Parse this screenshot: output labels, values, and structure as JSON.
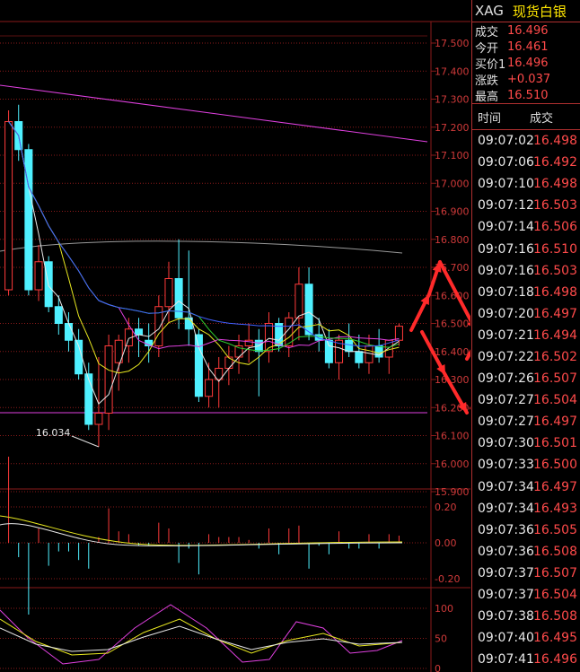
{
  "quote": {
    "symbol": "XAG",
    "name": "现货白银",
    "rows": [
      {
        "label": "成交",
        "value": "16.496"
      },
      {
        "label": "今开",
        "value": "16.461"
      },
      {
        "label": "买价1",
        "value": "16.496"
      },
      {
        "label": "涨跌",
        "value": "+0.037"
      },
      {
        "label": "最高",
        "value": "16.510"
      }
    ]
  },
  "ticks": {
    "headers": [
      "时间",
      "成交"
    ],
    "rows": [
      {
        "time": "09:07:02",
        "price": "16.498"
      },
      {
        "time": "09:07:06",
        "price": "16.492"
      },
      {
        "time": "09:07:10",
        "price": "16.498"
      },
      {
        "time": "09:07:12",
        "price": "16.503"
      },
      {
        "time": "09:07:14",
        "price": "16.506"
      },
      {
        "time": "09:07:16",
        "price": "16.510"
      },
      {
        "time": "09:07:16",
        "price": "16.503"
      },
      {
        "time": "09:07:18",
        "price": "16.498"
      },
      {
        "time": "09:07:20",
        "price": "16.497"
      },
      {
        "time": "09:07:21",
        "price": "16.494"
      },
      {
        "time": "09:07:22",
        "price": "16.502"
      },
      {
        "time": "09:07:26",
        "price": "16.507"
      },
      {
        "time": "09:07:27",
        "price": "16.504"
      },
      {
        "time": "09:07:27",
        "price": "16.497"
      },
      {
        "time": "09:07:30",
        "price": "16.501"
      },
      {
        "time": "09:07:33",
        "price": "16.500"
      },
      {
        "time": "09:07:34",
        "price": "16.497"
      },
      {
        "time": "09:07:34",
        "price": "16.493"
      },
      {
        "time": "09:07:36",
        "price": "16.505"
      },
      {
        "time": "09:07:36",
        "price": "16.508"
      },
      {
        "time": "09:07:37",
        "price": "16.507"
      },
      {
        "time": "09:07:37",
        "price": "16.504"
      },
      {
        "time": "09:07:38",
        "price": "16.508"
      },
      {
        "time": "09:07:40",
        "price": "16.495"
      },
      {
        "time": "09:07:41",
        "price": "16.496"
      }
    ]
  },
  "chart_data": {
    "type": "candlestick",
    "price_axis": {
      "ticks": [
        "17.500",
        "17.400",
        "17.300",
        "17.200",
        "17.100",
        "17.000",
        "16.900",
        "16.800",
        "16.700",
        "16.600",
        "16.500",
        "16.400",
        "16.300",
        "16.200",
        "16.100",
        "16.000",
        "15.900"
      ],
      "ylim": [
        15.9,
        17.5
      ]
    },
    "low_annotation": "16.034",
    "candles": [
      {
        "o": 16.62,
        "h": 17.26,
        "l": 16.6,
        "c": 17.22
      },
      {
        "o": 17.22,
        "h": 17.28,
        "l": 17.08,
        "c": 17.12
      },
      {
        "o": 17.12,
        "h": 17.14,
        "l": 16.6,
        "c": 16.62
      },
      {
        "o": 16.62,
        "h": 16.78,
        "l": 16.58,
        "c": 16.72
      },
      {
        "o": 16.72,
        "h": 16.74,
        "l": 16.54,
        "c": 16.56
      },
      {
        "o": 16.56,
        "h": 16.6,
        "l": 16.46,
        "c": 16.5
      },
      {
        "o": 16.5,
        "h": 16.54,
        "l": 16.4,
        "c": 16.44
      },
      {
        "o": 16.44,
        "h": 16.48,
        "l": 16.3,
        "c": 16.32
      },
      {
        "o": 16.32,
        "h": 16.36,
        "l": 16.12,
        "c": 16.14
      },
      {
        "o": 16.14,
        "h": 16.38,
        "l": 16.06,
        "c": 16.18
      },
      {
        "o": 16.18,
        "h": 16.46,
        "l": 16.12,
        "c": 16.42
      },
      {
        "o": 16.36,
        "h": 16.46,
        "l": 16.26,
        "c": 16.44
      },
      {
        "o": 16.42,
        "h": 16.52,
        "l": 16.36,
        "c": 16.48
      },
      {
        "o": 16.48,
        "h": 16.52,
        "l": 16.38,
        "c": 16.46
      },
      {
        "o": 16.44,
        "h": 16.5,
        "l": 16.36,
        "c": 16.42
      },
      {
        "o": 16.42,
        "h": 16.6,
        "l": 16.38,
        "c": 16.56
      },
      {
        "o": 16.56,
        "h": 16.72,
        "l": 16.5,
        "c": 16.66
      },
      {
        "o": 16.66,
        "h": 16.8,
        "l": 16.48,
        "c": 16.52
      },
      {
        "o": 16.52,
        "h": 16.76,
        "l": 16.42,
        "c": 16.48
      },
      {
        "o": 16.46,
        "h": 16.48,
        "l": 16.22,
        "c": 16.24
      },
      {
        "o": 16.24,
        "h": 16.36,
        "l": 16.2,
        "c": 16.3
      },
      {
        "o": 16.3,
        "h": 16.38,
        "l": 16.2,
        "c": 16.34
      },
      {
        "o": 16.34,
        "h": 16.42,
        "l": 16.28,
        "c": 16.38
      },
      {
        "o": 16.38,
        "h": 16.46,
        "l": 16.32,
        "c": 16.42
      },
      {
        "o": 16.42,
        "h": 16.5,
        "l": 16.36,
        "c": 16.44
      },
      {
        "o": 16.44,
        "h": 16.48,
        "l": 16.24,
        "c": 16.4
      },
      {
        "o": 16.4,
        "h": 16.54,
        "l": 16.36,
        "c": 16.5
      },
      {
        "o": 16.5,
        "h": 16.52,
        "l": 16.4,
        "c": 16.42
      },
      {
        "o": 16.42,
        "h": 16.54,
        "l": 16.38,
        "c": 16.52
      },
      {
        "o": 16.52,
        "h": 16.7,
        "l": 16.44,
        "c": 16.64
      },
      {
        "o": 16.64,
        "h": 16.7,
        "l": 16.44,
        "c": 16.46
      },
      {
        "o": 16.46,
        "h": 16.52,
        "l": 16.4,
        "c": 16.44
      },
      {
        "o": 16.44,
        "h": 16.48,
        "l": 16.34,
        "c": 16.36
      },
      {
        "o": 16.36,
        "h": 16.46,
        "l": 16.3,
        "c": 16.44
      },
      {
        "o": 16.44,
        "h": 16.5,
        "l": 16.38,
        "c": 16.4
      },
      {
        "o": 16.4,
        "h": 16.46,
        "l": 16.34,
        "c": 16.36
      },
      {
        "o": 16.36,
        "h": 16.46,
        "l": 16.32,
        "c": 16.42
      },
      {
        "o": 16.42,
        "h": 16.48,
        "l": 16.36,
        "c": 16.38
      },
      {
        "o": 16.38,
        "h": 16.44,
        "l": 16.32,
        "c": 16.44
      },
      {
        "o": 16.44,
        "h": 16.5,
        "l": 16.42,
        "c": 16.49
      }
    ],
    "macd_axis": {
      "ticks": [
        "0.20",
        "0.00",
        "-0.20"
      ]
    },
    "kdj_axis": {
      "ticks": [
        "100",
        "50",
        "0"
      ]
    },
    "colors": {
      "up": "#ff3a3a",
      "down": "#4ff0ff",
      "ma_yellow": "#e8e820",
      "ma_white": "#e8e8e8",
      "ma_magenta": "#e040e0",
      "ma_green": "#30d030",
      "ma_blue": "#4060ff",
      "ma_gray": "#9a9a9a",
      "grid": "#8a1a1a",
      "arrow": "#ff2a2a"
    }
  }
}
